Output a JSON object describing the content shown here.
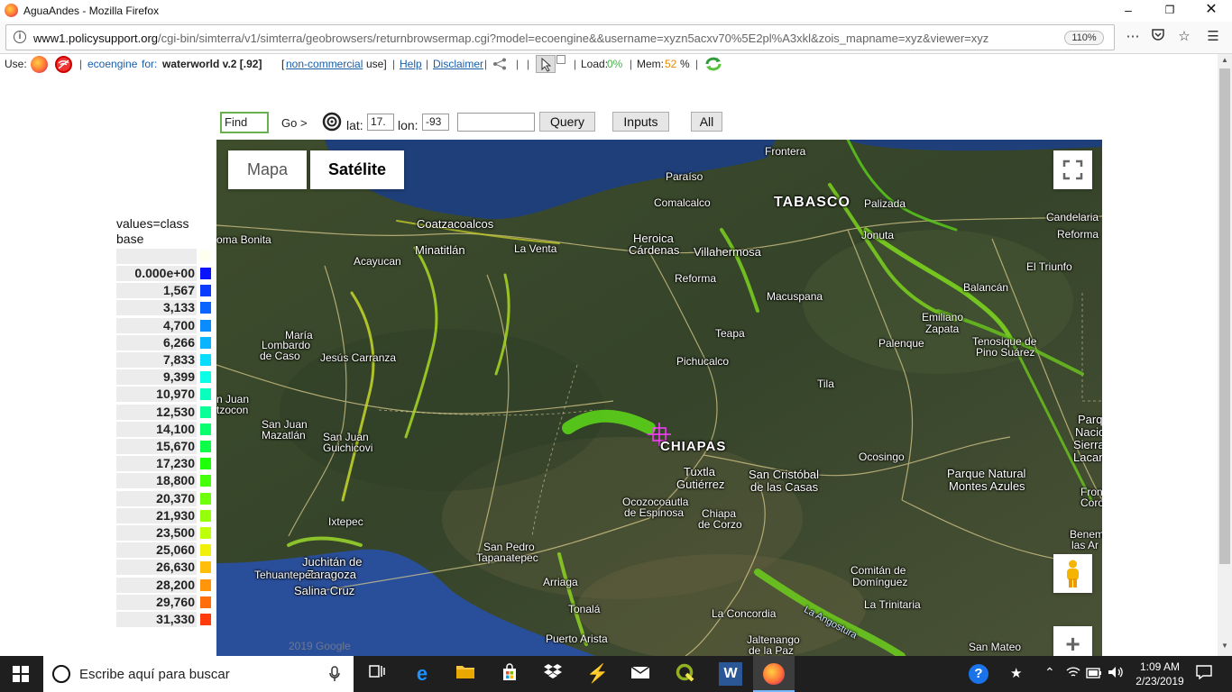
{
  "window": {
    "title": "AguaAndes - Mozilla Firefox"
  },
  "browser": {
    "url_domain": "www1.policysupport.org",
    "url_path": "/cgi-bin/simterra/v1/simterra/geobrowsers/returnbrowsermap.cgi?model=ecoengine&&username=xyzn5acxv70%5E2pl%A3xkl&zois_mapname=xyz&viewer=xyz",
    "zoom": "110%"
  },
  "apptoolbar": {
    "use_label": "Use:",
    "engine_link": "ecoengine",
    "for_label": "for:",
    "model_name": "waterworld v.2 [.92]",
    "license_open": "[",
    "license_link": "non-commercial",
    "license_close": "use]",
    "help": "Help",
    "disclaimer": "Disclaimer",
    "load_label": "Load:",
    "load_value": "0%",
    "mem_label": "Mem:",
    "mem_value": "52",
    "mem_unit": "%"
  },
  "query": {
    "find_placeholder": "Find",
    "go_label": "Go >",
    "lat_label": "lat:",
    "lat_value": "17.",
    "lon_label": "lon:",
    "lon_value": "-93",
    "query_button": "Query",
    "inputs_button": "Inputs",
    "all_button": "All"
  },
  "legend": {
    "title_line1": "values=class",
    "title_line2": "base",
    "rows": [
      {
        "label": "0.000e+00",
        "color": "#0a14ff"
      },
      {
        "label": "1,567",
        "color": "#0a3cff"
      },
      {
        "label": "3,133",
        "color": "#0a64ff"
      },
      {
        "label": "4,700",
        "color": "#0a8cff"
      },
      {
        "label": "6,266",
        "color": "#0ab4ff"
      },
      {
        "label": "7,833",
        "color": "#0adcff"
      },
      {
        "label": "9,399",
        "color": "#0affe6"
      },
      {
        "label": "10,970",
        "color": "#0affbe"
      },
      {
        "label": "12,530",
        "color": "#0aff96"
      },
      {
        "label": "14,100",
        "color": "#0aff6e"
      },
      {
        "label": "15,670",
        "color": "#0aff46"
      },
      {
        "label": "17,230",
        "color": "#1eff0a"
      },
      {
        "label": "18,800",
        "color": "#46ff0a"
      },
      {
        "label": "20,370",
        "color": "#6eff0a"
      },
      {
        "label": "21,930",
        "color": "#96ff0a"
      },
      {
        "label": "23,500",
        "color": "#beff0a"
      },
      {
        "label": "25,060",
        "color": "#f0f00a"
      },
      {
        "label": "26,630",
        "color": "#ffbe0a"
      },
      {
        "label": "28,200",
        "color": "#ff960a"
      },
      {
        "label": "29,760",
        "color": "#ff6e0a"
      },
      {
        "label": "31,330",
        "color": "#ff3c0a"
      }
    ]
  },
  "map": {
    "type_map": "Mapa",
    "type_satellite": "Satélite",
    "watermark": "2019 Google",
    "places": {
      "frontera": "Frontera",
      "paraiso": "Paraíso",
      "tabasco": "TABASCO",
      "palizada": "Palizada",
      "comalcalco": "Comalcalco",
      "candelaria": "Candelaria",
      "coatzacoalcos": "Coatzacoalcos",
      "heroica": "Heroica",
      "cardenas": "Cárdenas",
      "villahermosa": "Villahermosa",
      "jonuta": "Jonuta",
      "reforma1": "Reforma",
      "loma_bonita": "oma Bonita",
      "minatitlan": "Minatitlán",
      "la_venta": "La Venta",
      "el_triunfo": "El Triunfo",
      "acayucan": "Acayucan",
      "reforma2": "Reforma",
      "macuspana": "Macuspana",
      "balancan": "Balancán",
      "emiliano": "Emiliano",
      "zapata": "Zapata",
      "maria_lombardo1": "María",
      "maria_lombardo2": "Lombardo",
      "maria_lombardo3": "de Caso",
      "teapa": "Teapa",
      "palenque": "Palenque",
      "tenosique1": "Tenosique de",
      "tenosique2": "Pino Suárez",
      "jesus_carranza": "Jesús Carranza",
      "pichucalco": "Pichucalco",
      "tila": "Tila",
      "san_juan_e1": "n Juan",
      "san_juan_e2": "tzocon",
      "san_juan_m1": "San Juan",
      "san_juan_m2": "Mazatlán",
      "san_juan_g1": "San Juan",
      "san_juan_g2": "Guichicovi",
      "chiapas": "CHIAPAS",
      "parque_n1": "Parq",
      "parque_n2": "Nacio",
      "parque_n3": "Sierra",
      "parque_n4": "Lacanc",
      "tuxtla1": "Tuxtla",
      "tuxtla2": "Gutiérrez",
      "san_cristobal1": "San Cristóbal",
      "san_cristobal2": "de las Casas",
      "ocosingo": "Ocosingo",
      "montes_azules1": "Parque Natural",
      "montes_azules2": "Montes Azules",
      "front1": "Fron",
      "front2": "Coro",
      "ocozocoautla1": "Ocozocoautla",
      "ocozocoautla2": "de Espinosa",
      "chiapa1": "Chiapa",
      "chiapa2": "de Corzo",
      "ixtepec": "Ixtepec",
      "benem1": "Benem",
      "benem2": "las Ar",
      "juchitan1": "Juchitán de",
      "juchitan2": "Zaragoza",
      "san_pedro1": "San Pedro",
      "san_pedro2": "Tapanatepec",
      "tehuantepec": "Tehuantepec",
      "salina_cruz": "Salina Cruz",
      "arriaga": "Arriaga",
      "comitan1": "Comitán de",
      "comitan2": "Domínguez",
      "la_trinitaria": "La Trinitaria",
      "tonala": "Tonalá",
      "la_concordia": "La Concordia",
      "puerto_arista": "Puerto Arista",
      "jaltenango1": "Jaltenango",
      "jaltenango2": "de la Paz",
      "la_angostura": "La Angostura",
      "san_mateo": "San Mateo"
    }
  },
  "taskbar": {
    "search_placeholder": "Escribe aquí para buscar",
    "time": "1:09 AM",
    "date": "2/23/2019"
  },
  "colors": {
    "accent_green": "#5bd11a",
    "browser_chrome": "#f9f9fa",
    "taskbar": "#1f1f1f"
  }
}
